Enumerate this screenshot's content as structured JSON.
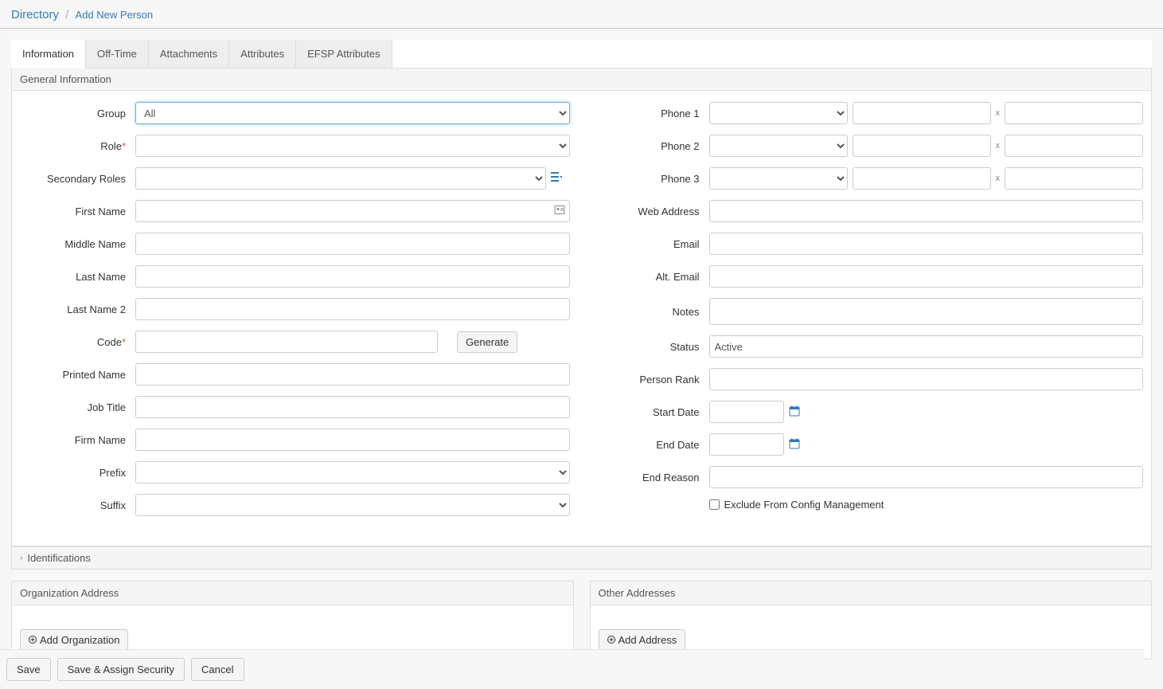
{
  "breadcrumb": {
    "root": "Directory",
    "current": "Add New Person"
  },
  "tabs": {
    "information": "Information",
    "offtime": "Off-Time",
    "attachments": "Attachments",
    "attributes": "Attributes",
    "efsp": "EFSP Attributes"
  },
  "sections": {
    "general": "General Information",
    "identifications": "Identifications",
    "org_address": "Organization Address",
    "other_addresses": "Other Addresses"
  },
  "labels": {
    "group": "Group",
    "role": "Role",
    "secondary_roles": "Secondary Roles",
    "first_name": "First Name",
    "middle_name": "Middle Name",
    "last_name": "Last Name",
    "last_name2": "Last Name 2",
    "code": "Code",
    "printed_name": "Printed Name",
    "job_title": "Job Title",
    "firm_name": "Firm Name",
    "prefix": "Prefix",
    "suffix": "Suffix",
    "phone1": "Phone 1",
    "phone2": "Phone 2",
    "phone3": "Phone 3",
    "web_address": "Web Address",
    "email": "Email",
    "alt_email": "Alt. Email",
    "notes": "Notes",
    "status": "Status",
    "person_rank": "Person Rank",
    "start_date": "Start Date",
    "end_date": "End Date",
    "end_reason": "End Reason",
    "exclude_config": "Exclude From Config Management"
  },
  "values": {
    "group": "All",
    "role": "",
    "secondary_roles": "",
    "first_name": "",
    "middle_name": "",
    "last_name": "",
    "last_name2": "",
    "code": "",
    "printed_name": "",
    "job_title": "",
    "firm_name": "",
    "prefix": "",
    "suffix": "",
    "web_address": "",
    "email": "",
    "alt_email": "",
    "notes": "",
    "status": "Active",
    "person_rank": "",
    "start_date": "",
    "end_date": "",
    "end_reason": "",
    "exclude_config": false,
    "phone1": {
      "type": "",
      "number": "",
      "x": "x",
      "ext": ""
    },
    "phone2": {
      "type": "",
      "number": "",
      "x": "x",
      "ext": ""
    },
    "phone3": {
      "type": "",
      "number": "",
      "x": "x",
      "ext": ""
    }
  },
  "buttons": {
    "generate": "Generate",
    "add_org": "Add Organization",
    "add_address": "Add Address",
    "save": "Save",
    "save_assign": "Save & Assign Security",
    "cancel": "Cancel"
  },
  "options": {
    "group": [
      "All"
    ]
  }
}
